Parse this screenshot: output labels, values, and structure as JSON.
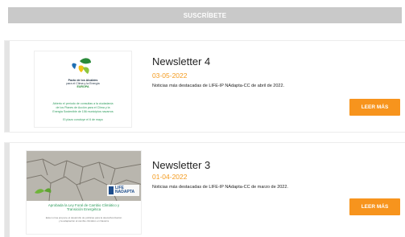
{
  "subscribe": {
    "label": "SUSCRÍBETE"
  },
  "newsletters": [
    {
      "title": "Newsletter 4",
      "date": "03-05-2022",
      "description": "Noticias más destacadas de LIFE-IP NAdapta-CC de abril de 2022.",
      "button": "LEER MÁS",
      "thumb": {
        "logo_line1": "Pacto de los Alcaldes",
        "logo_line2": "para el Clima y la Energía",
        "logo_line3": "EUROPA",
        "caption_lines": [
          "Abierto el período de consultas a la ciudadanía",
          "de los Planes de Acción para el Clima y la",
          "Energía Sostenible de 156 municipios navarros"
        ],
        "footnote": "El plazo concluye el 6 de mayo"
      }
    },
    {
      "title": "Newsletter 3",
      "date": "01-04-2022",
      "description": "Noticias más destacadas de LIFE-IP NAdapta-CC de marzo de 2022.",
      "button": "LEER MÁS",
      "thumb": {
        "badge_line1": "LIFE",
        "badge_line2": "NADAPTA",
        "caption_lines": [
          "Aprobada la Ley Foral de Cambio Climático y",
          "Transición Energética"
        ],
        "small_lines": [
          "Esta norma propone el desarrollo de políticas para la descarbonización",
          "y la adaptación al cambio climático en Navarra"
        ]
      }
    }
  ],
  "colors": {
    "accent": "#f7941d",
    "date": "#f39a1e",
    "subscribe_bg": "#c9c9c9"
  }
}
